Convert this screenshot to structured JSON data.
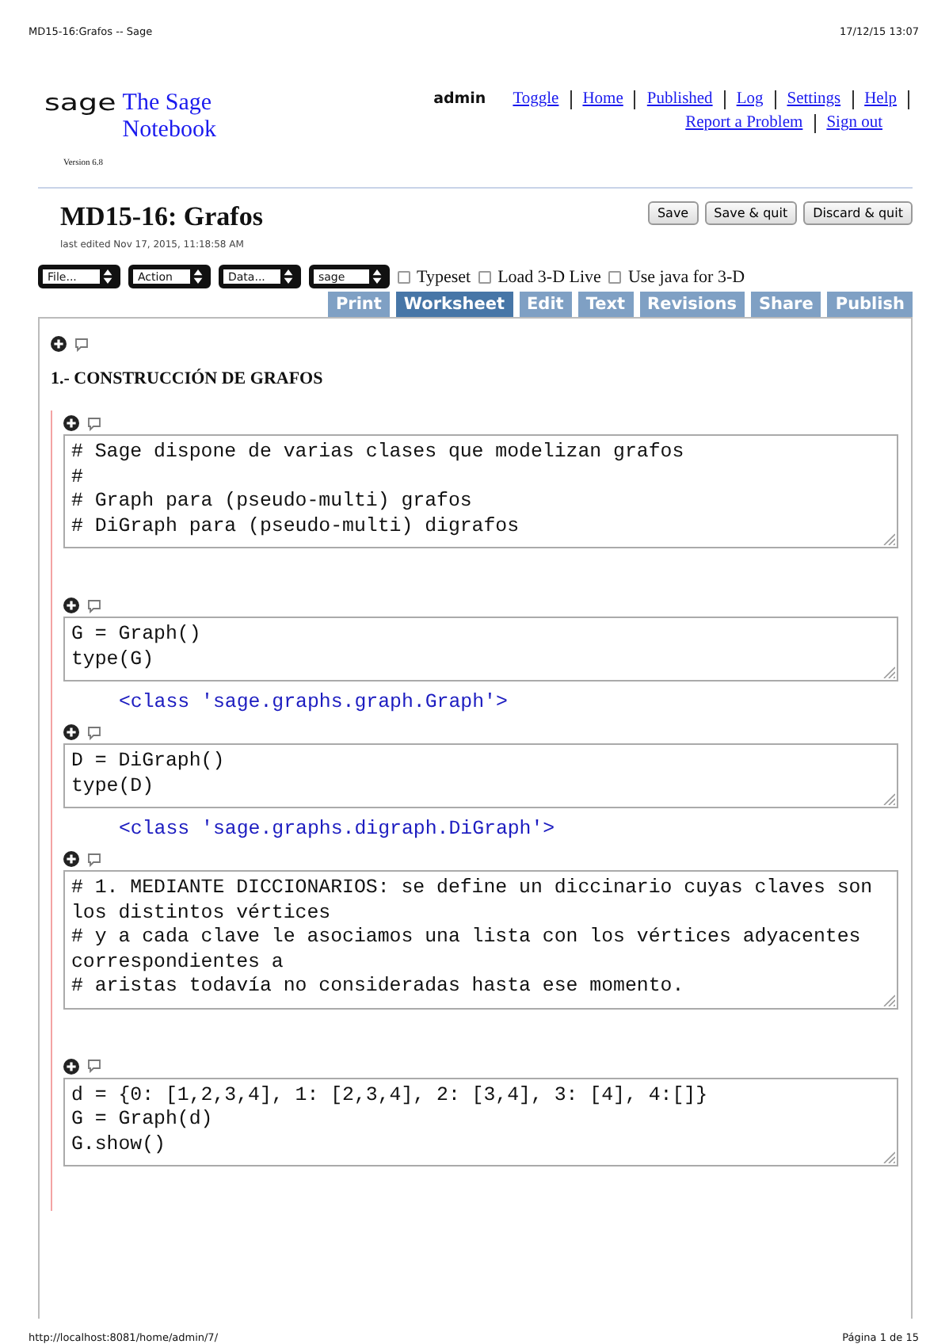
{
  "print_header": {
    "left": "MD15-16:Grafos -- Sage",
    "right": "17/12/15 13:07"
  },
  "brand": {
    "logo": "sage",
    "title": "The Sage Notebook",
    "version": "Version 6.8"
  },
  "user": "admin",
  "nav_links": [
    {
      "label": "Toggle"
    },
    {
      "label": "Home"
    },
    {
      "label": "Published"
    },
    {
      "label": "Log"
    },
    {
      "label": "Settings"
    },
    {
      "label": "Help"
    }
  ],
  "nav_links_2": [
    {
      "label": "Report a Problem"
    },
    {
      "label": "Sign out"
    }
  ],
  "worksheet": {
    "title": "MD15-16: Grafos",
    "last_edited": "last edited Nov 17, 2015, 11:18:58 AM"
  },
  "actions": [
    "Save",
    "Save & quit",
    "Discard & quit"
  ],
  "selects": [
    "File...",
    "Action",
    "Data...",
    "sage"
  ],
  "options": [
    {
      "label": "Typeset",
      "checked": false
    },
    {
      "label": "Load 3-D Live",
      "checked": false
    },
    {
      "label": "Use java for 3-D",
      "checked": false
    }
  ],
  "tabs": [
    {
      "label": "Print",
      "selected": false
    },
    {
      "label": "Worksheet",
      "selected": true
    },
    {
      "label": "Edit",
      "selected": false
    },
    {
      "label": "Text",
      "selected": false
    },
    {
      "label": "Revisions",
      "selected": false
    },
    {
      "label": "Share",
      "selected": false
    },
    {
      "label": "Publish",
      "selected": false
    }
  ],
  "cells": [
    {
      "kind": "text",
      "heading": "1.- CONSTRUCCIÓN DE GRAFOS"
    },
    {
      "kind": "compute",
      "input": [
        "# Sage dispone de varias clases que modelizan grafos",
        "#",
        "# Graph para (pseudo-multi) grafos",
        "# DiGraph para (pseudo-multi) digrafos"
      ]
    },
    {
      "kind": "compute",
      "input": [
        "G = Graph()",
        "type(G)"
      ],
      "output": "<class 'sage.graphs.graph.Graph'>"
    },
    {
      "kind": "compute",
      "input": [
        "D = DiGraph()",
        "type(D)"
      ],
      "output": "<class 'sage.graphs.digraph.DiGraph'>"
    },
    {
      "kind": "compute",
      "input": [
        "# 1. MEDIANTE DICCIONARIOS: se define un diccinario cuyas claves son los distintos vértices",
        "# y a cada clave le asociamos una lista con los vértices adyacentes correspondientes a",
        "# aristas todavía no consideradas hasta ese momento."
      ]
    },
    {
      "kind": "compute",
      "input": [
        "d = {0: [1,2,3,4], 1: [2,3,4], 2: [3,4], 3: [4], 4:[]}",
        "G = Graph(d)",
        "G.show()"
      ]
    }
  ],
  "print_footer": {
    "left": "http://localhost:8081/home/admin/7/",
    "right": "Página 1 de 15"
  }
}
